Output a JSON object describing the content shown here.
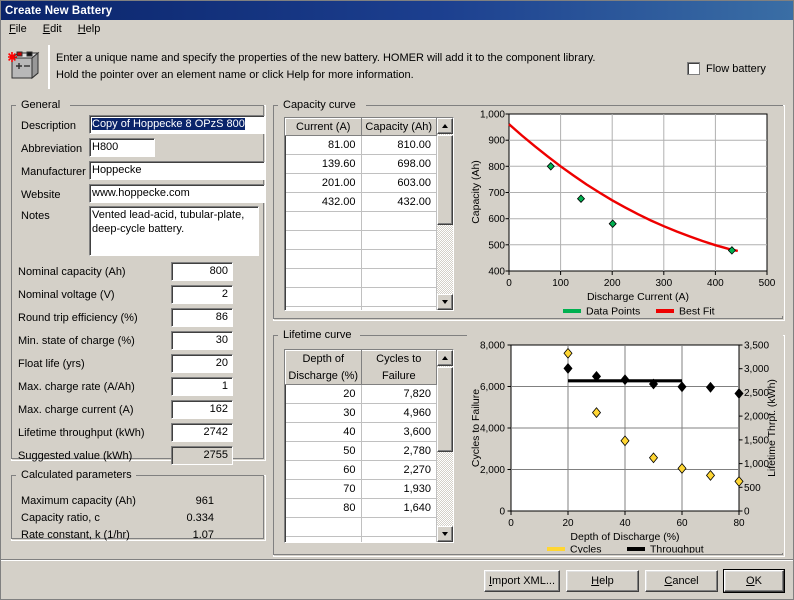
{
  "window": {
    "title": "Create New Battery"
  },
  "menu": {
    "items": [
      {
        "label": "File",
        "accel": "F"
      },
      {
        "label": "Edit",
        "accel": "E"
      },
      {
        "label": "Help",
        "accel": "H"
      }
    ]
  },
  "hint": {
    "icon": "battery-icon",
    "line1": "Enter a unique name and specify the properties of the new battery. HOMER will add it to the component library.",
    "line2": "Hold the pointer over an element name or click Help for more information."
  },
  "flow_battery": {
    "label": "Flow battery",
    "checked": false
  },
  "general": {
    "title": "General",
    "description": {
      "label": "Description",
      "value": "Copy of Hoppecke 8 OPzS 800",
      "selected": true
    },
    "abbreviation": {
      "label": "Abbreviation",
      "value": "H800"
    },
    "manufacturer": {
      "label": "Manufacturer",
      "value": "Hoppecke"
    },
    "website": {
      "label": "Website",
      "value": "www.hoppecke.com"
    },
    "notes": {
      "label": "Notes",
      "line1": "Vented lead-acid, tubular-plate,",
      "line2": "deep-cycle battery."
    },
    "fields": [
      {
        "label": "Nominal capacity (Ah)",
        "value": "800",
        "readonly": false
      },
      {
        "label": "Nominal voltage (V)",
        "value": "2",
        "readonly": false
      },
      {
        "label": "Round trip efficiency (%)",
        "value": "86",
        "readonly": false
      },
      {
        "label": "Min. state of charge (%)",
        "value": "30",
        "readonly": false
      },
      {
        "label": "Float life (yrs)",
        "value": "20",
        "readonly": false
      },
      {
        "label": "Max. charge rate (A/Ah)",
        "value": "1",
        "readonly": false
      },
      {
        "label": "Max. charge current (A)",
        "value": "162",
        "readonly": false
      },
      {
        "label": "Lifetime throughput (kWh)",
        "value": "2742",
        "readonly": false
      },
      {
        "label": "Suggested value (kWh)",
        "value": "2755",
        "readonly": true
      }
    ]
  },
  "calculated": {
    "title": "Calculated parameters",
    "rows": [
      {
        "label": "Maximum capacity (Ah)",
        "value": "961"
      },
      {
        "label": "Capacity ratio, c",
        "value": "0.334"
      },
      {
        "label": "Rate constant, k (1/hr)",
        "value": "1.07"
      }
    ]
  },
  "capacity_curve": {
    "title": "Capacity curve",
    "columns": [
      "Current (A)",
      "Capacity (Ah)"
    ],
    "rows": [
      [
        "81.00",
        "810.00"
      ],
      [
        "139.60",
        "698.00"
      ],
      [
        "201.00",
        "603.00"
      ],
      [
        "432.00",
        "432.00"
      ]
    ],
    "empty_rows": 6
  },
  "lifetime_curve": {
    "title": "Lifetime curve",
    "columns_line1": [
      "Depth of",
      "Cycles to"
    ],
    "columns_line2": [
      "Discharge (%)",
      "Failure"
    ],
    "rows": [
      [
        "20",
        "7,820"
      ],
      [
        "30",
        "4,960"
      ],
      [
        "40",
        "3,600"
      ],
      [
        "50",
        "2,780"
      ],
      [
        "60",
        "2,270"
      ],
      [
        "70",
        "1,930"
      ],
      [
        "80",
        "1,640"
      ]
    ],
    "empty_rows": 3
  },
  "buttons": {
    "import_xml": {
      "label": "Import XML...",
      "accel": "I"
    },
    "help": {
      "label": "Help",
      "accel": "H"
    },
    "cancel": {
      "label": "Cancel",
      "accel": "C"
    },
    "ok": {
      "label": "OK",
      "accel": "O",
      "default": true
    }
  },
  "colors": {
    "titlebar_start": "#0a246a",
    "titlebar_end": "#3a6ea5",
    "face": "#d4d0c8",
    "best_fit": "#ee0000",
    "data_points": "#00b050",
    "cycles": "#ffd633",
    "throughput": "#000000",
    "selection": "#0a246a"
  },
  "chart_data": [
    {
      "type": "scatter",
      "id": "capacity-curve-chart",
      "title": "",
      "xlabel": "Discharge Current (A)",
      "ylabel": "Capacity (Ah)",
      "xlim": [
        0,
        500
      ],
      "ylim": [
        400,
        1000
      ],
      "xticks": [
        0,
        100,
        200,
        300,
        400,
        500
      ],
      "yticks": [
        400,
        500,
        600,
        700,
        800,
        900,
        1000
      ],
      "ytick_labels": [
        "400",
        "500",
        "600",
        "700",
        "800",
        "900",
        "1,000"
      ],
      "grid": true,
      "legend_position": "bottom",
      "series": [
        {
          "name": "Data Points",
          "color": "#00b050",
          "marker": "diamond",
          "x": [
            81.0,
            139.6,
            201.0,
            432.0
          ],
          "y": [
            810,
            698,
            603,
            432
          ]
        },
        {
          "name": "Best Fit",
          "color": "#ee0000",
          "type": "line",
          "x": [
            0,
            25,
            50,
            75,
            100,
            125,
            150,
            175,
            200,
            225,
            250,
            275,
            300,
            325,
            350,
            375,
            400,
            425,
            440
          ],
          "y": [
            961,
            918,
            877,
            838,
            800,
            765,
            731,
            700,
            670,
            643,
            617,
            593,
            571,
            551,
            532,
            515,
            499,
            485,
            477
          ]
        }
      ]
    },
    {
      "type": "scatter",
      "id": "lifetime-curve-chart",
      "title": "",
      "xlabel": "Depth of Discharge (%)",
      "ylabel": "Cycles to Failure",
      "y2label": "Lifetime Thrpt. (kWh)",
      "xlim": [
        0,
        80
      ],
      "ylim": [
        0,
        8000
      ],
      "y2lim": [
        0,
        3500
      ],
      "xticks": [
        0,
        20,
        40,
        60,
        80
      ],
      "yticks": [
        0,
        2000,
        4000,
        6000,
        8000
      ],
      "ytick_labels": [
        "0",
        "2,000",
        "4,000",
        "6,000",
        "8,000"
      ],
      "y2ticks": [
        0,
        500,
        1000,
        1500,
        2000,
        2500,
        3000,
        3500
      ],
      "y2tick_labels": [
        "0",
        "500",
        "1,000",
        "1,500",
        "2,000",
        "2,500",
        "3,000",
        "3,500"
      ],
      "grid": true,
      "legend_position": "bottom",
      "series": [
        {
          "name": "Cycles",
          "color": "#ffd633",
          "marker": "diamond",
          "axis": "left",
          "x": [
            20,
            30,
            40,
            50,
            60,
            70,
            80
          ],
          "y": [
            7820,
            4960,
            3600,
            2780,
            2270,
            1930,
            1640
          ]
        },
        {
          "name": "Throughput",
          "color": "#000000",
          "marker": "diamond",
          "axis": "right",
          "x": [
            20,
            30,
            40,
            50,
            60,
            70,
            80
          ],
          "y": [
            3010,
            2840,
            2770,
            2680,
            2620,
            2610,
            2480
          ]
        },
        {
          "name": "Throughput Line",
          "color": "#000000",
          "type": "line",
          "axis": "right",
          "x": [
            20,
            70
          ],
          "y": [
            2745,
            2745
          ]
        }
      ]
    }
  ]
}
